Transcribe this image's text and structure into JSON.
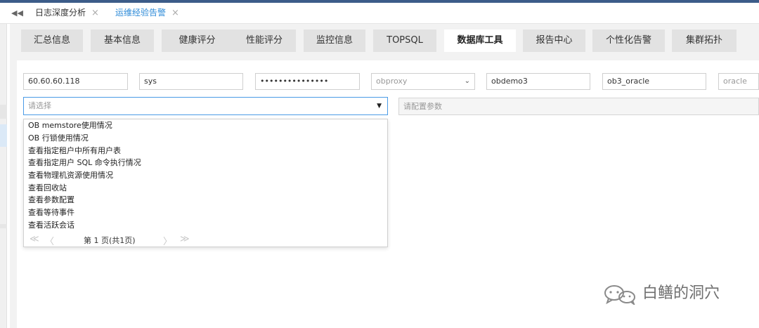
{
  "window_tabs": [
    {
      "label": "日志深度分析",
      "close": "×"
    },
    {
      "label": "运维经验告警",
      "close": "×"
    }
  ],
  "tab_nav_icon": "double-left-arrow-icon",
  "accent_color": "#2e8bd8",
  "sub_tabs": [
    "汇总信息",
    "基本信息",
    "健康评分",
    "性能评分",
    "监控信息",
    "TOPSQL",
    "数据库工具",
    "报告中心",
    "个性化告警",
    "集群拓扑"
  ],
  "active_sub_tab": "数据库工具",
  "connection": {
    "host": "60.60.60.118",
    "user": "sys",
    "password": "•••••••••••••••",
    "proxy_select": "obproxy",
    "tenant": "obdemo3",
    "cluster": "ob3_oracle",
    "db_type": "oracle"
  },
  "sql_select": {
    "placeholder": "请选择",
    "caret": "▼"
  },
  "param_input": {
    "placeholder": "请配置参数"
  },
  "dropdown": {
    "items": [
      "OB memstore使用情况",
      "OB 行锁使用情况",
      "查看指定租户中所有用户表",
      "查看指定用户 SQL 命令执行情况",
      "查看物理机资源使用情况",
      "查看回收站",
      "查看参数配置",
      "查看等待事件",
      "查看活跃会话"
    ],
    "pager": {
      "first": "≪",
      "prev": "〈",
      "text": "第 1 页(共1页)",
      "next": "〉",
      "last": "≫"
    }
  },
  "watermark": {
    "text": "白鳝的洞穴",
    "icon": "wechat-icon"
  }
}
